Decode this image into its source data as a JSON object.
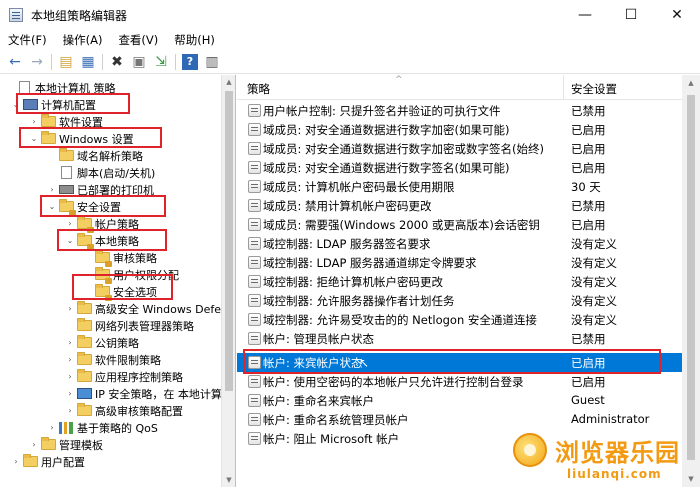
{
  "window": {
    "title": "本地组策略编辑器",
    "controls": {
      "minimize": "—",
      "maximize": "☐",
      "close": "✕"
    }
  },
  "menu": [
    "文件(F)",
    "操作(A)",
    "查看(V)",
    "帮助(H)"
  ],
  "toolbar": {
    "back": "←",
    "forward": "→",
    "folder": "▤",
    "view": "▦",
    "delete": "✖",
    "properties": "▣",
    "export": "⇲",
    "help": "?",
    "panel": "▥",
    "icons": [
      "back-arrow-icon",
      "forward-arrow-icon",
      "up-folder-icon",
      "show-hide-tree-icon",
      "delete-icon",
      "properties-icon",
      "export-list-icon",
      "help-icon",
      "view-pane-icon"
    ]
  },
  "tree": {
    "items": [
      {
        "label": "本地计算机 策略",
        "icon": "policy-doc-icon"
      },
      {
        "label": "计算机配置",
        "icon": "computer-icon"
      },
      {
        "label": "软件设置",
        "icon": "folder-icon"
      },
      {
        "label": "Windows 设置",
        "icon": "folder-icon"
      },
      {
        "label": "域名解析策略",
        "icon": "folder-icon"
      },
      {
        "label": "脚本(启动/关机)",
        "icon": "script-icon"
      },
      {
        "label": "已部署的打印机",
        "icon": "printer-icon"
      },
      {
        "label": "安全设置",
        "icon": "security-folder-icon"
      },
      {
        "label": "帐户策略",
        "icon": "security-folder-icon"
      },
      {
        "label": "本地策略",
        "icon": "security-folder-icon"
      },
      {
        "label": "审核策略",
        "icon": "security-folder-icon"
      },
      {
        "label": "用户权限分配",
        "icon": "security-folder-icon"
      },
      {
        "label": "安全选项",
        "icon": "security-folder-icon"
      },
      {
        "label": "高级安全 Windows Defer",
        "icon": "folder-icon"
      },
      {
        "label": "网络列表管理器策略",
        "icon": "folder-icon"
      },
      {
        "label": "公钥策略",
        "icon": "folder-icon"
      },
      {
        "label": "软件限制策略",
        "icon": "folder-icon"
      },
      {
        "label": "应用程序控制策略",
        "icon": "folder-icon"
      },
      {
        "label": "IP 安全策略，在 本地计算",
        "icon": "ip-security-icon"
      },
      {
        "label": "高级审核策略配置",
        "icon": "folder-icon"
      },
      {
        "label": "基于策略的 QoS",
        "icon": "qos-chart-icon"
      },
      {
        "label": "管理模板",
        "icon": "folder-icon"
      },
      {
        "label": "用户配置",
        "icon": "folder-icon"
      }
    ]
  },
  "list": {
    "headers": {
      "policy": "策略",
      "setting": "安全设置"
    },
    "rows": [
      {
        "policy": "用户帐户控制: 只提升签名并验证的可执行文件",
        "setting": "已禁用"
      },
      {
        "policy": "域成员: 对安全通道数据进行数字加密(如果可能)",
        "setting": "已启用"
      },
      {
        "policy": "域成员: 对安全通道数据进行数字加密或数字签名(始终)",
        "setting": "已启用"
      },
      {
        "policy": "域成员: 对安全通道数据进行数字签名(如果可能)",
        "setting": "已启用"
      },
      {
        "policy": "域成员: 计算机帐户密码最长使用期限",
        "setting": "30 天"
      },
      {
        "policy": "域成员: 禁用计算机帐户密码更改",
        "setting": "已禁用"
      },
      {
        "policy": "域成员: 需要强(Windows 2000 或更高版本)会话密钥",
        "setting": "已启用"
      },
      {
        "policy": "域控制器: LDAP 服务器签名要求",
        "setting": "没有定义"
      },
      {
        "policy": "域控制器: LDAP 服务器通道绑定令牌要求",
        "setting": "没有定义"
      },
      {
        "policy": "域控制器: 拒绝计算机帐户密码更改",
        "setting": "没有定义"
      },
      {
        "policy": "域控制器: 允许服务器操作者计划任务",
        "setting": "没有定义"
      },
      {
        "policy": "域控制器:  允许易受攻击的的 Netlogon 安全通道连接",
        "setting": "没有定义"
      },
      {
        "policy": "帐户: 管理员帐户状态",
        "setting": "已禁用"
      },
      {
        "policy": "帐户: 来宾帐户状态",
        "setting": "已启用"
      },
      {
        "policy": "帐户: 使用空密码的本地帐户只允许进行控制台登录",
        "setting": "已启用"
      },
      {
        "policy": "帐户: 重命名来宾帐户",
        "setting": "Guest"
      },
      {
        "policy": "帐户: 重命名系统管理员帐户",
        "setting": "Administrator"
      },
      {
        "policy": "帐户: 阻止 Microsoft 帐户",
        "setting": ""
      }
    ]
  },
  "watermark": {
    "title": "浏览器乐园",
    "subtitle": "liulanqi.com",
    "logo": "watermark-logo"
  },
  "colors": {
    "selection": "#0078d7",
    "highlight_box": "#e0222b",
    "folder": "#f3cf61",
    "watermark": "#f29b12"
  }
}
